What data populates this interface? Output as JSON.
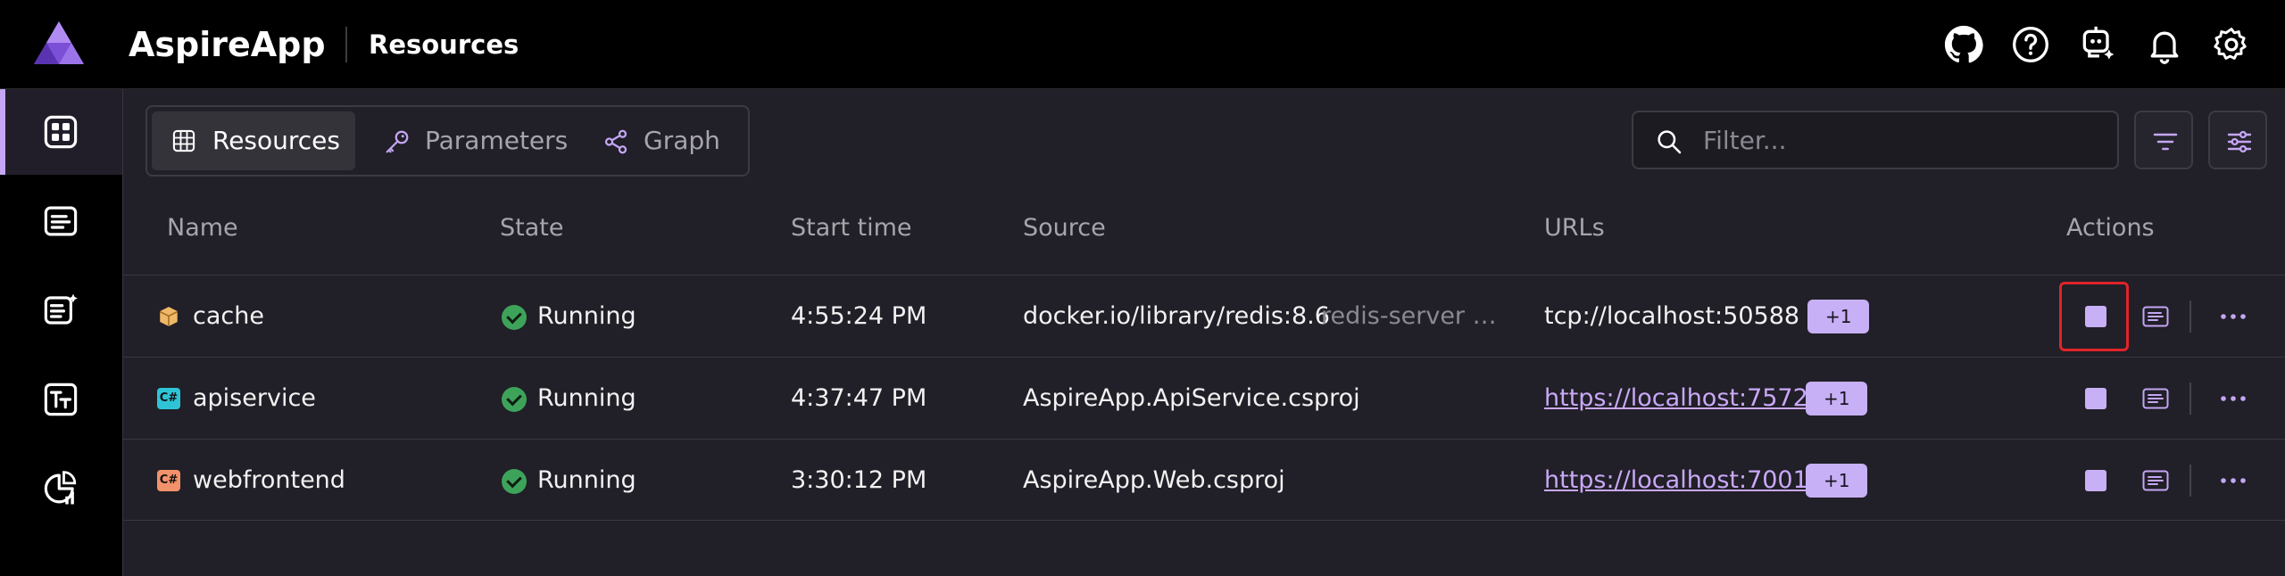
{
  "header": {
    "app_title": "AspireApp",
    "page_name": "Resources",
    "icons": [
      "github-icon",
      "help-icon",
      "copilot-icon",
      "notifications-icon",
      "settings-icon"
    ]
  },
  "sidebar": {
    "items": [
      {
        "name": "resources",
        "icon": "grid-icon",
        "active": true
      },
      {
        "name": "console-logs",
        "icon": "console-icon",
        "active": false
      },
      {
        "name": "structured-logs",
        "icon": "structured-logs-icon",
        "active": false
      },
      {
        "name": "traces",
        "icon": "traces-icon",
        "active": false
      },
      {
        "name": "metrics",
        "icon": "metrics-icon",
        "active": false
      }
    ]
  },
  "tabs": [
    {
      "label": "Resources",
      "icon": "table-icon",
      "selected": true
    },
    {
      "label": "Parameters",
      "icon": "key-icon",
      "selected": false
    },
    {
      "label": "Graph",
      "icon": "share-icon",
      "selected": false
    }
  ],
  "filter": {
    "placeholder": "Filter...",
    "value": ""
  },
  "table": {
    "headers": {
      "name": "Name",
      "state": "State",
      "start_time": "Start time",
      "source": "Source",
      "urls": "URLs",
      "actions": "Actions"
    },
    "rows": [
      {
        "name": "cache",
        "type_icon": "container-icon",
        "state": "Running",
        "start_time": "4:55:24 PM",
        "source": "docker.io/library/redis:8.6",
        "source_extra": "redis-server …",
        "url": "tcp://localhost:50588",
        "url_is_link": false,
        "more_urls": "+1"
      },
      {
        "name": "apiservice",
        "type_icon": "csharp-project-icon",
        "type_badge": "C#",
        "state": "Running",
        "start_time": "4:37:47 PM",
        "source": "AspireApp.ApiService.csproj",
        "source_extra": "",
        "url": "https://localhost:7572",
        "url_is_link": true,
        "more_urls": "+1"
      },
      {
        "name": "webfrontend",
        "type_icon": "csharp-project-icon",
        "type_badge": "C#",
        "state": "Running",
        "start_time": "3:30:12 PM",
        "source": "AspireApp.Web.csproj",
        "source_extra": "",
        "url": "https://localhost:7001",
        "url_is_link": true,
        "more_urls": "+1"
      }
    ]
  },
  "colors": {
    "accent": "#c7b0f5",
    "running": "#3ea35a",
    "highlight": "#e0242a",
    "apiservice_badge": "#2ec4d6",
    "webfrontend_badge": "#f2926a"
  }
}
